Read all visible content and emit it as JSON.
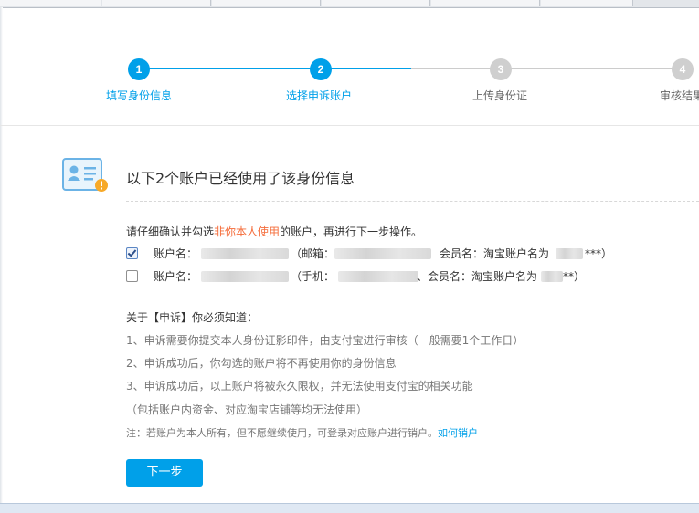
{
  "steps": [
    {
      "number": "1",
      "label": "填写身份信息",
      "state": "active"
    },
    {
      "number": "2",
      "label": "选择申诉账户",
      "state": "active"
    },
    {
      "number": "3",
      "label": "上传身份证",
      "state": "inactive"
    },
    {
      "number": "4",
      "label": "审核结果",
      "state": "inactive"
    }
  ],
  "colors": {
    "accent": "#00a0e9",
    "highlight": "#f56c3a",
    "inactive": "#cfcfcf"
  },
  "main_title": "以下2个账户已经使用了该身份信息",
  "instruction": {
    "prefix": "请仔细确认并勾选",
    "highlight": "非你本人使用",
    "suffix": "的账户，再进行下一步操作。"
  },
  "accounts": [
    {
      "checked": true,
      "name_label": "账户名：",
      "contact_label": "（邮箱：",
      "member_label": "会员名：淘宝账户名为",
      "member_tail": "***）"
    },
    {
      "checked": false,
      "name_label": "账户名：",
      "contact_label": "（手机：",
      "member_label": "、会员名：淘宝账户名为",
      "member_tail": "**）"
    }
  ],
  "notice": {
    "title": "关于【申诉】你必须知道：",
    "items": [
      "1、申诉需要你提交本人身份证影印件，由支付宝进行审核（一般需要1个工作日）",
      "2、申诉成功后，你勾选的账户将不再使用你的身份信息",
      "3、申诉成功后，以上账户将被永久限权，并无法使用支付宝的相关功能",
      "（包括账户内资金、对应淘宝店铺等均无法使用）"
    ],
    "note_text": "注：若账户为本人所有，但不愿继续使用，可登录对应账户进行销户。",
    "note_link": "如何销户"
  },
  "next_button": "下一步"
}
